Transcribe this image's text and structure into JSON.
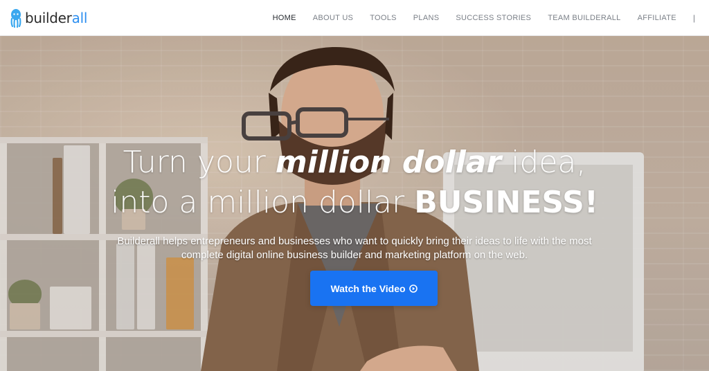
{
  "brand": {
    "name_main": "builder",
    "name_accent": "all"
  },
  "nav": {
    "items": [
      {
        "label": "HOME",
        "active": true
      },
      {
        "label": "ABOUT US"
      },
      {
        "label": "TOOLS"
      },
      {
        "label": "PLANS"
      },
      {
        "label": "SUCCESS STORIES"
      },
      {
        "label": "TEAM BUILDERALL"
      },
      {
        "label": "AFFILIATE"
      }
    ],
    "separator": "|"
  },
  "hero": {
    "line1_pre": "Turn your ",
    "line1_emph": "million dollar",
    "line1_post": " idea,",
    "line2_pre": "into a million dollar ",
    "line2_emph": "BUSINESS!",
    "subtext": "Builderall helps entrepreneurs and businesses who want to quickly bring their ideas to life with the most complete digital online business builder and marketing platform on the web.",
    "cta_label": "Watch the Video",
    "cta_icon": "play-circle-icon"
  },
  "colors": {
    "accent": "#2d8ff0",
    "cta": "#1973f2",
    "nav_active": "#262a2f",
    "nav_inactive": "#7a7f87"
  }
}
